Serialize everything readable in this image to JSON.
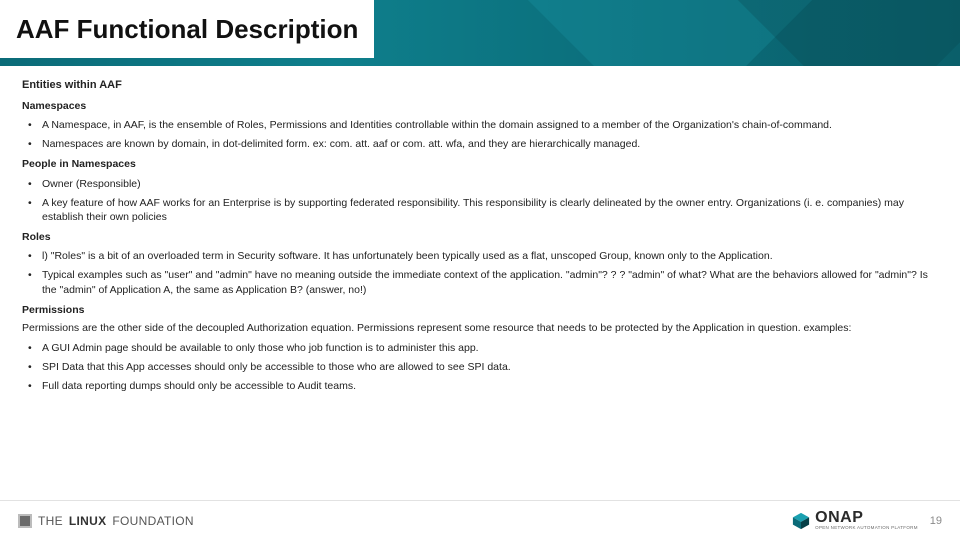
{
  "header": {
    "title": "AAF Functional Description"
  },
  "section_title": "Entities within AAF",
  "namespaces": {
    "heading": "Namespaces",
    "items": [
      "A Namespace, in AAF, is the ensemble of Roles, Permissions and Identities controllable within the domain assigned to a member of the Organization's chain-of-command.",
      "Namespaces are known by domain, in dot-delimited form.  ex:   com. att. aaf or com. att. wfa, and they are hierarchically managed."
    ]
  },
  "people": {
    "heading": "People in Namespaces",
    "items": [
      "Owner (Responsible)",
      "A key feature of how AAF works for an Enterprise is by supporting federated responsibility.  This responsibility is clearly delineated by the owner entry.  Organizations (i. e. companies) may establish their own policies"
    ]
  },
  "roles": {
    "heading": "Roles",
    "items": [
      "l)  \"Roles\" is a bit of an overloaded term in Security software.  It has unfortunately been typically used as a flat, unscoped Group, known only to the Application.",
      " Typical examples such as \"user\" and \"admin\" have no meaning outside the immediate context of the application.  \"admin\"? ? ?  \"admin\" of what?  What are the behaviors allowed for \"admin\"?  Is the \"admin\" of Application A, the same as Application B? (answer, no!)"
    ]
  },
  "permissions": {
    "heading": "Permissions",
    "intro": "Permissions are the other side of the decoupled Authorization equation.  Permissions represent some resource that needs to be protected by the Application in question. examples:",
    "items": [
      "A GUI Admin page should be available to only those who job function is to administer this app.",
      "SPI Data that this App accesses should only be accessible to those who are allowed to see SPI data.",
      "Full data reporting dumps should only be accessible to Audit teams."
    ]
  },
  "footer": {
    "linux_foundation": {
      "the": "THE",
      "linux": "LINUX",
      "foundation": "FOUNDATION"
    },
    "onap": {
      "name": "ONAP",
      "sub": "OPEN NETWORK AUTOMATION PLATFORM"
    },
    "page": "19"
  }
}
